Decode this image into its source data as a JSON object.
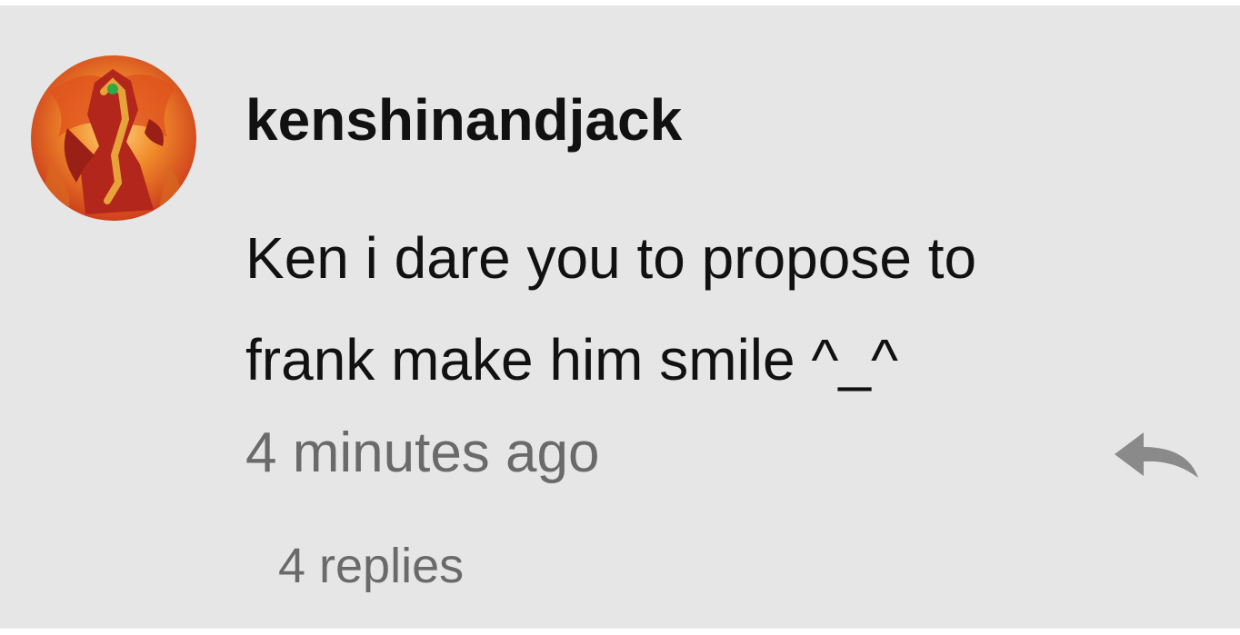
{
  "comment": {
    "username": "kenshinandjack",
    "text_line1": "Ken i dare you to propose to",
    "text_line2": "frank make him smile ^_^",
    "timestamp": "4 minutes ago",
    "replies_label": "4 replies",
    "avatar_icon": "dragon-avatar-icon",
    "reply_icon": "reply-arrow-icon"
  },
  "colors": {
    "background": "#e6e6e6",
    "primary_text": "#111111",
    "secondary_text": "#6a6a6a",
    "icon": "#8a8a8a"
  }
}
